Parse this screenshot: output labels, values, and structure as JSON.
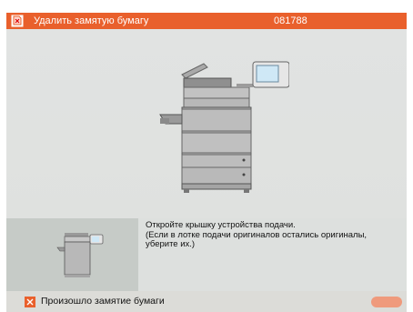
{
  "header": {
    "title": "Удалить замятую бумагу",
    "code": "081788",
    "icon": "paper-jam-icon",
    "color": "#e9602c"
  },
  "instruction": {
    "text": "Откройте крышку устройства подачи.\n(Если в лотке подачи оригиналов остались оригиналы, уберите их.)"
  },
  "status": {
    "text": "Произошло замятие бумаги",
    "icon": "warning-icon"
  },
  "colors": {
    "panel": "#dde0de",
    "thumb_panel": "#c6cbc7",
    "accent": "#e9602c"
  }
}
